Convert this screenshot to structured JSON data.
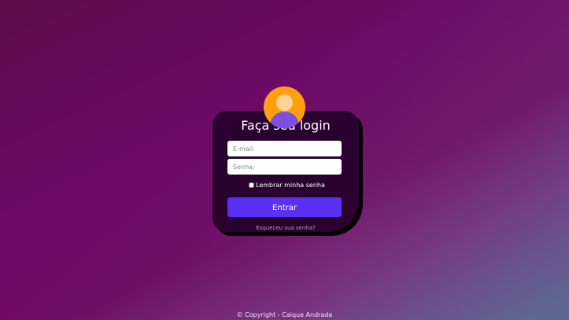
{
  "login": {
    "title": "Faça seu login",
    "email_placeholder": "E-mail:",
    "password_placeholder": "Senha:",
    "remember_label": "Lembrar minha senha",
    "submit_label": "Entrar",
    "forgot_link": "Esqueceu sua senha?",
    "avatar_icon": "user-avatar-icon"
  },
  "footer": {
    "copyright": "© Copyright - Caique Andrade"
  },
  "colors": {
    "card_background": "#2a0230",
    "submit_button": "#5a31f4",
    "avatar_background": "#ff9f0f",
    "avatar_body": "#7c4fe0"
  }
}
